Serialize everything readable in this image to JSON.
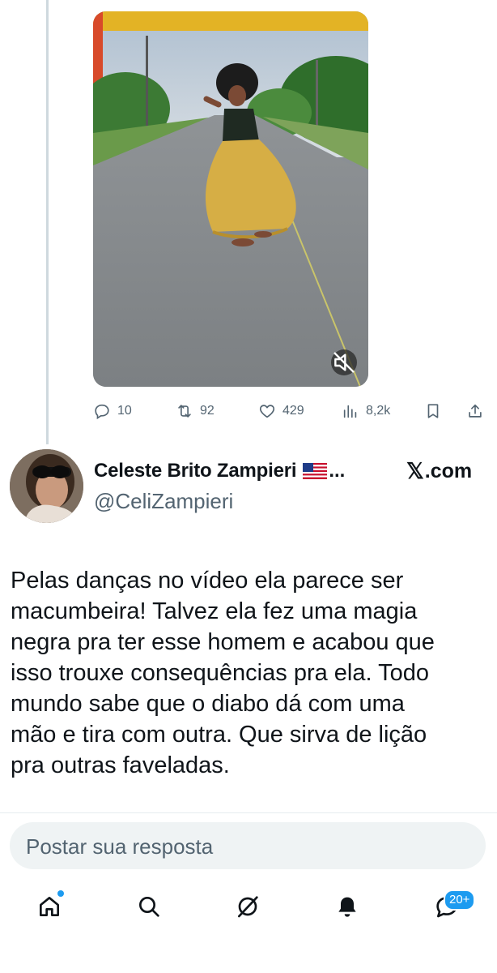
{
  "video": {
    "mute_icon": "speaker-muted-icon"
  },
  "actions": {
    "replies": "10",
    "reposts": "92",
    "likes": "429",
    "views": "8,2k"
  },
  "reply_tweet": {
    "author_name": "Celeste Brito Zampieri",
    "ellipsis": "...",
    "source": ".com",
    "handle": "@CeliZampieri",
    "text": "Pelas danças no vídeo ela parece ser\nmacumbeira! Talvez ela fez uma magia\nnegra pra ter esse homem e acabou que\nisso trouxe consequências pra ela. Todo\nmundo sabe que o diabo dá com uma\nmão e tira com outra. Que sirva de lição\npra outras faveladas."
  },
  "compose": {
    "placeholder": "Postar sua resposta"
  },
  "bottom_nav": {
    "messages_badge": "20+"
  },
  "colors": {
    "accent": "#1d9bf0",
    "secondary_text": "#536471",
    "compose_bg": "#eff3f4"
  }
}
